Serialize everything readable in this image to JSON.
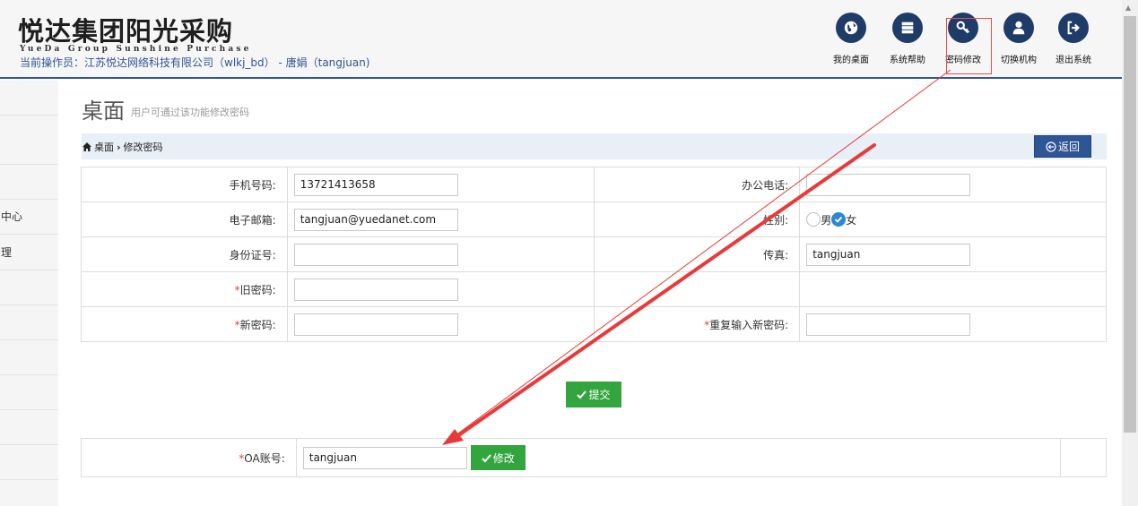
{
  "header": {
    "logo_cn": "悦达集团阳光采购",
    "logo_en": "YueDa Group Sunshine Purchase",
    "operator": "当前操作员：江苏悦达网络科技有限公司（wlkj_bd） - 唐娟（tangjuan)",
    "nav": [
      {
        "label": "我的桌面",
        "icon": "globe-icon"
      },
      {
        "label": "系统帮助",
        "icon": "server-icon"
      },
      {
        "label": "密码修改",
        "icon": "key-icon"
      },
      {
        "label": "切换机构",
        "icon": "user-icon"
      },
      {
        "label": "退出系统",
        "icon": "sign-out-icon"
      }
    ]
  },
  "sidebar": {
    "items": [
      "",
      "",
      "",
      "中心",
      "理",
      "",
      "",
      "",
      "",
      "",
      ""
    ]
  },
  "page": {
    "title": "桌面",
    "subtitle": "用户可通过该功能修改密码"
  },
  "breadcrumb": {
    "home": "桌面",
    "current": "修改密码",
    "back_label": "返回"
  },
  "form": {
    "mobile_label": "手机号码:",
    "mobile_value": "13721413658",
    "office_phone_label": "办公电话:",
    "office_phone_value": "",
    "email_label": "电子邮箱:",
    "email_value": "tangjuan@yuedanet.com",
    "gender_label": "性别:",
    "gender_male": "男",
    "gender_female": "女",
    "gender_selected": "女",
    "id_label": "身份证号:",
    "id_value": "",
    "fax_label": "传真:",
    "fax_value": "tangjuan",
    "required_mark": "*",
    "old_password_label": "旧密码:",
    "new_password_label": "新密码:",
    "repeat_password_label": "重复输入新密码:",
    "submit_label": "提交"
  },
  "oa": {
    "label": "OA账号:",
    "value": "tangjuan",
    "modify_label": "修改"
  },
  "colors": {
    "primary": "#2e5596",
    "nav_icon": "#1f3c68",
    "success": "#33a53f",
    "required": "#e53b3b",
    "annotation": "#e83a3a"
  }
}
